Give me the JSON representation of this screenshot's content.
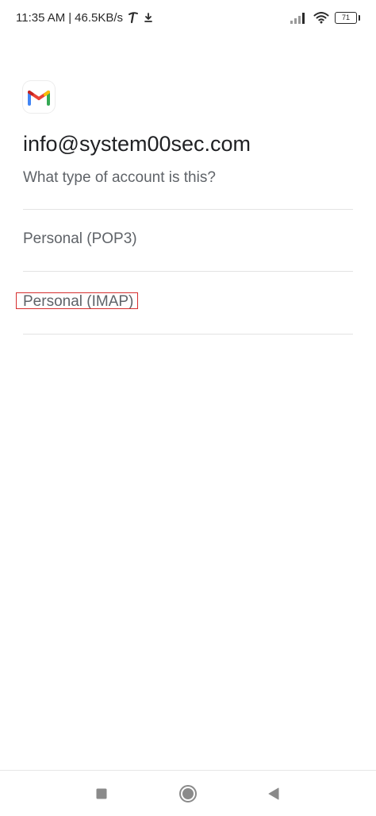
{
  "status_bar": {
    "time": "11:35 AM",
    "separator": "|",
    "network_speed": "46.5KB/s",
    "battery_level": "71",
    "icons": [
      "carrier-icon",
      "download-icon",
      "signal-icon",
      "wifi-icon",
      "battery-icon"
    ]
  },
  "header": {
    "app_icon": "gmail-icon",
    "email": "info@system00sec.com",
    "question": "What type of account is this?"
  },
  "options": [
    {
      "label": "Personal (POP3)"
    },
    {
      "label": "Personal (IMAP)",
      "highlighted": true
    }
  ],
  "nav_bar": {
    "icons": [
      "recent-apps-icon",
      "home-icon",
      "back-icon"
    ]
  },
  "colors": {
    "highlight_border": "#d62e2e",
    "gmail_blue": "#4285F4",
    "gmail_red": "#EA4335",
    "gmail_yellow": "#FBBC04",
    "gmail_green": "#34A853",
    "text_primary": "#202124",
    "text_secondary": "#5f6368"
  }
}
